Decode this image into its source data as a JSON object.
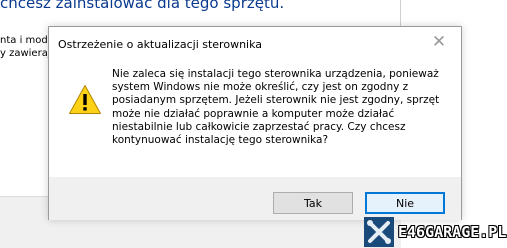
{
  "background_window": {
    "header_text": "chcesz zainstalować dla tego sprzętu.",
    "side_lines": [
      "nta i mod",
      "y zawieraj"
    ]
  },
  "dialog": {
    "title": "Ostrzeżenie o aktualizacji sterownika",
    "close_glyph": "✕",
    "icon": "warning-icon",
    "message": "Nie zaleca się instalacji tego sterownika urządzenia, ponieważ\nsystem Windows nie może określić, czy jest on zgodny z\nposiadanym sprzętem.  Jeżeli sterownik nie jest zgodny, sprzęt\nmoże nie działać poprawnie a komputer może działać\nniestabilnie lub całkowicie zaprzestać pracy.  Czy chcesz\nkontynuować instalację tego sterownika?",
    "buttons": {
      "yes": "Tak",
      "no": "Nie"
    }
  },
  "watermark": {
    "text": "E46GARAGE.PL"
  },
  "colors": {
    "focus_border": "#0078d7",
    "warning_yellow": "#fcd116",
    "footer_bg": "#f0f0f0"
  }
}
